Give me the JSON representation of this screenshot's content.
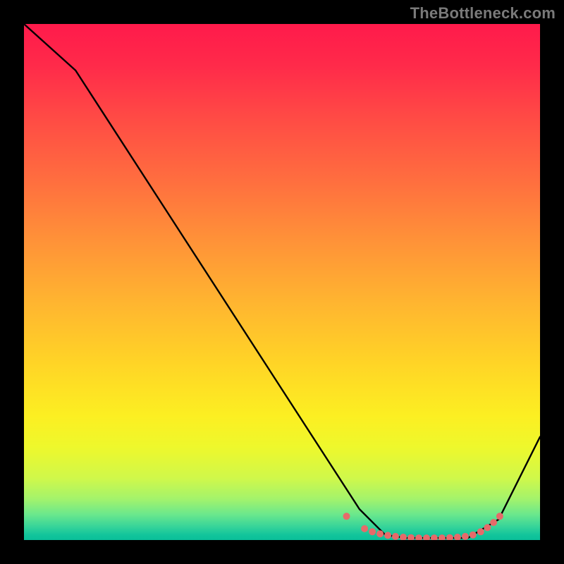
{
  "watermark": "TheBottleneck.com",
  "chart_data": {
    "type": "line",
    "title": "",
    "xlabel": "",
    "ylabel": "",
    "xlim": [
      0,
      100
    ],
    "ylim": [
      0,
      100
    ],
    "series": [
      {
        "name": "curve",
        "x": [
          0,
          10,
          65,
          70,
          74,
          86,
          92,
          100
        ],
        "y": [
          100,
          91,
          6,
          1,
          0.4,
          0.4,
          4,
          20
        ]
      }
    ],
    "markers": {
      "name": "highlight-points",
      "x": [
        62.5,
        66,
        67.5,
        69,
        70.5,
        72,
        73.5,
        75,
        76.5,
        78,
        79.5,
        81,
        82.5,
        84,
        85.5,
        87,
        88.5,
        89.8,
        91,
        92.2
      ],
      "y": [
        4.6,
        2.2,
        1.6,
        1.2,
        0.9,
        0.7,
        0.55,
        0.45,
        0.4,
        0.4,
        0.4,
        0.4,
        0.45,
        0.55,
        0.7,
        1.0,
        1.6,
        2.4,
        3.4,
        4.6
      ]
    },
    "gradient": {
      "orientation": "vertical",
      "stops": [
        {
          "pos": 0.0,
          "color": "#ff1a4b"
        },
        {
          "pos": 0.3,
          "color": "#ff6d3f"
        },
        {
          "pos": 0.66,
          "color": "#ffd526"
        },
        {
          "pos": 0.88,
          "color": "#d0f84a"
        },
        {
          "pos": 1.0,
          "color": "#0abf99"
        }
      ]
    }
  }
}
